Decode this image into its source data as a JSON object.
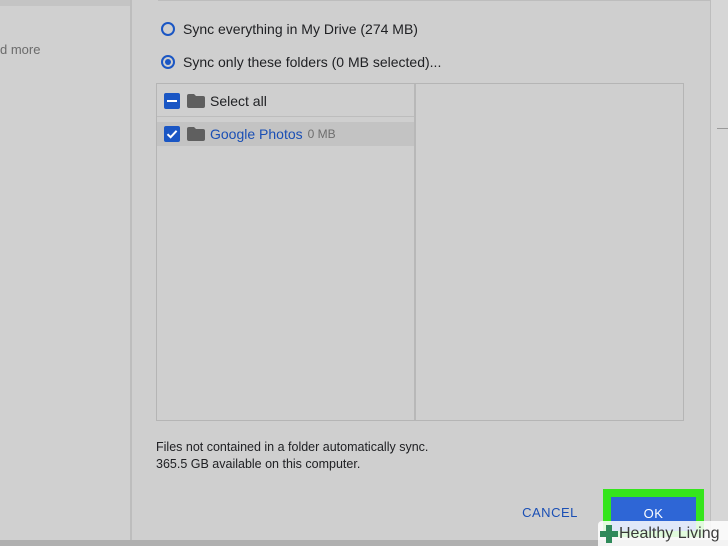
{
  "left_panel": {
    "truncated_text": "d more"
  },
  "sync_options": {
    "everything_label": "Sync everything in My Drive (274 MB)",
    "only_label": "Sync only these folders (0 MB selected)..."
  },
  "folders": {
    "select_all_label": "Select all",
    "items": [
      {
        "name": "Google Photos",
        "size": "0 MB"
      }
    ]
  },
  "info": {
    "line1": "Files not contained in a folder automatically sync.",
    "line2": "365.5 GB available on this computer."
  },
  "buttons": {
    "cancel": "CANCEL",
    "ok": "OK"
  },
  "watermark": {
    "text": "Healthy Living"
  },
  "colors": {
    "accent": "#1a56c4",
    "ok_button": "#2e66d6",
    "highlight": "#35e51c",
    "background": "#cfcfcf"
  }
}
